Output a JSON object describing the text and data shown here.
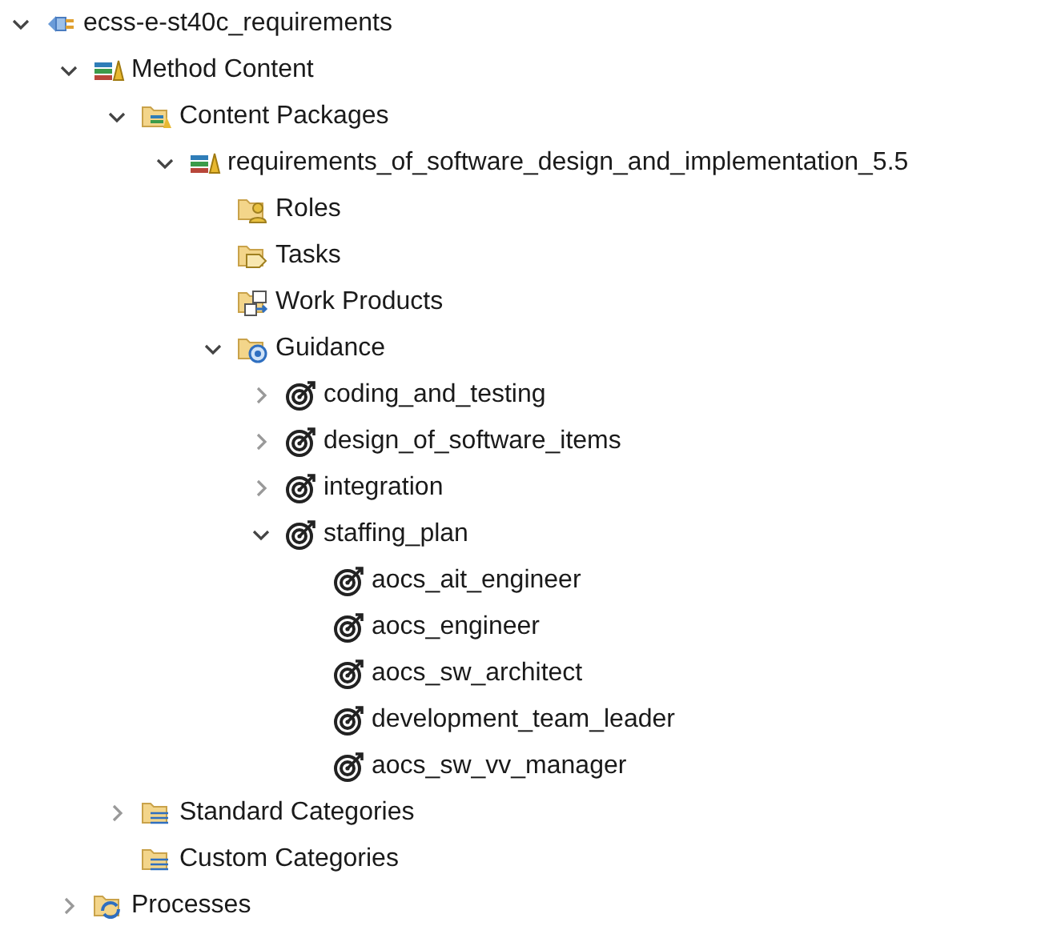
{
  "tree": [
    {
      "label": "ecss-e-st40c_requirements",
      "kind": "plugin",
      "expanded": true,
      "children": [
        {
          "label": "Method Content",
          "kind": "library",
          "expanded": true,
          "children": [
            {
              "label": "Content Packages",
              "kind": "packages",
              "expanded": true,
              "children": [
                {
                  "label": "requirements_of_software_design_and_implementation_5.5",
                  "kind": "library",
                  "expanded": true,
                  "children": [
                    {
                      "label": "Roles",
                      "kind": "roles"
                    },
                    {
                      "label": "Tasks",
                      "kind": "tasks"
                    },
                    {
                      "label": "Work Products",
                      "kind": "workproducts"
                    },
                    {
                      "label": "Guidance",
                      "kind": "guidance",
                      "expanded": true,
                      "children": [
                        {
                          "label": "coding_and_testing",
                          "kind": "plan",
                          "expanded": false
                        },
                        {
                          "label": "design_of_software_items",
                          "kind": "plan",
                          "expanded": false
                        },
                        {
                          "label": "integration",
                          "kind": "plan",
                          "expanded": false
                        },
                        {
                          "label": "staffing_plan",
                          "kind": "plan",
                          "expanded": true,
                          "children": [
                            {
                              "label": "aocs_ait_engineer",
                              "kind": "plan"
                            },
                            {
                              "label": "aocs_engineer",
                              "kind": "plan"
                            },
                            {
                              "label": "aocs_sw_architect",
                              "kind": "plan"
                            },
                            {
                              "label": "development_team_leader",
                              "kind": "plan"
                            },
                            {
                              "label": "aocs_sw_vv_manager",
                              "kind": "plan"
                            }
                          ]
                        }
                      ]
                    }
                  ]
                }
              ]
            },
            {
              "label": "Standard Categories",
              "kind": "categories",
              "expanded": false
            },
            {
              "label": "Custom Categories",
              "kind": "categories"
            }
          ]
        },
        {
          "label": "Processes",
          "kind": "processes",
          "expanded": false
        }
      ]
    }
  ]
}
